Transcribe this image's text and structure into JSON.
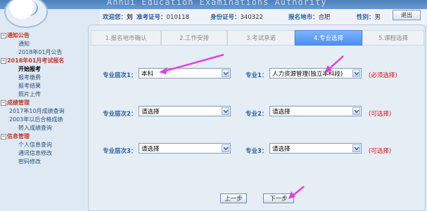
{
  "banner": {
    "title": "Anhui  Education  Examinations  Authority"
  },
  "info": {
    "welcome_label": "欢迎您：",
    "welcome_name": "刘",
    "ticket_label": "准考证号：",
    "ticket_value": "010118",
    "id_label": "身份证号：",
    "id_value": "340322",
    "city_label": "报名地市：",
    "city_value": "合肥",
    "gender_label": "性别：",
    "gender_value": "男",
    "exit_label": "退出"
  },
  "sidebar": {
    "groups": [
      {
        "title": "通知公告",
        "items": [
          "通知",
          "2018年01月公告"
        ]
      },
      {
        "title": "2018年01月考试报名",
        "items": [
          "开始报考",
          "报考缴费",
          "报考结果",
          "照片上传"
        ]
      },
      {
        "title": "成绩管理",
        "items": [
          "2017年10月成绩查询",
          "2003年以后合格成绩",
          "转入成绩查询"
        ]
      },
      {
        "title": "信息管理",
        "items": [
          "个人信息查询",
          "通讯信息修改",
          "密码修改"
        ]
      }
    ]
  },
  "steps": [
    "1.报名地市确认",
    "2.工作安排",
    "3.考试承诺",
    "4.专业选择",
    "5.课程选择"
  ],
  "form": {
    "row1": {
      "level_label": "专业层次1：",
      "level_value": "本科",
      "major_label": "专业1：",
      "major_value": "人力资源管理(独立本科段)",
      "hint": "(必须选择)"
    },
    "row2": {
      "level_label": "专业层次2：",
      "level_value": "请选择",
      "major_label": "专业2：",
      "major_value": "请选择",
      "hint": "(可选择)"
    },
    "row3": {
      "level_label": "专业层次3：",
      "level_value": "请选择",
      "major_label": "专业3：",
      "major_value": "请选择",
      "hint": "(可选择)"
    }
  },
  "buttons": {
    "prev": "上一步",
    "next": "下一步"
  },
  "colors": {
    "accent": "#4a90f0",
    "annotation": "#e040e0",
    "required": "#dd1111"
  }
}
